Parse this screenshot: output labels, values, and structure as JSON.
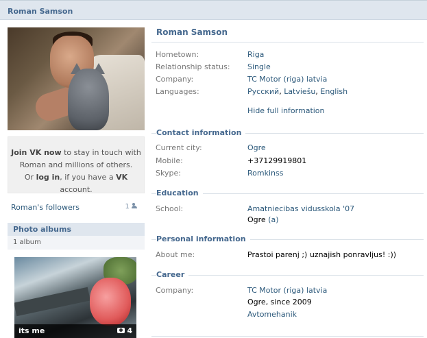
{
  "header": {
    "title": "Roman Samson"
  },
  "profile": {
    "name": "Roman Samson"
  },
  "basic_info": [
    {
      "label": "Hometown:",
      "value": "Riga"
    },
    {
      "label": "Relationship status:",
      "value": "Single"
    },
    {
      "label": "Company:",
      "value": "TC Motor (riga) latvia"
    },
    {
      "label": "Languages:",
      "value_parts": [
        "Русский",
        "Latviešu",
        "English"
      ]
    }
  ],
  "hide_full_info": "Hide full information",
  "contact": {
    "title": "Contact information",
    "rows": [
      {
        "label": "Current city:",
        "value": "Ogre"
      },
      {
        "label": "Mobile:",
        "value": "+37129919801"
      },
      {
        "label": "Skype:",
        "value": "Romkinss"
      }
    ]
  },
  "education": {
    "title": "Education",
    "school_label": "School:",
    "school_name": "Amatniecibas vidusskola '07",
    "school_city": "Ogre",
    "school_extra": "(a)"
  },
  "personal": {
    "title": "Personal information",
    "about_label": "About me:",
    "about_value": "Prastoi parenj ;) uznajish ponravljus! :))"
  },
  "career": {
    "title": "Career",
    "company_label": "Company:",
    "company": "TC Motor (riga) latvia",
    "location": "Ogre, since 2009",
    "position": "Avtomehanik"
  },
  "join_box": {
    "join_text": "Join VK now",
    "line1_rest": " to stay in touch with",
    "line2": "Roman and millions of others.",
    "line3_pre": "Or ",
    "login": "log in",
    "line3_mid": ", if you have a ",
    "vk": "VK",
    "line3_post": " account."
  },
  "followers": {
    "label": "Roman's followers",
    "count": "1"
  },
  "albums": {
    "title": "Photo albums",
    "count_text": "1 album",
    "album_name": "its me",
    "photo_count": "4"
  },
  "icons": {
    "followers": "people-icon",
    "album": "camera-icon"
  }
}
